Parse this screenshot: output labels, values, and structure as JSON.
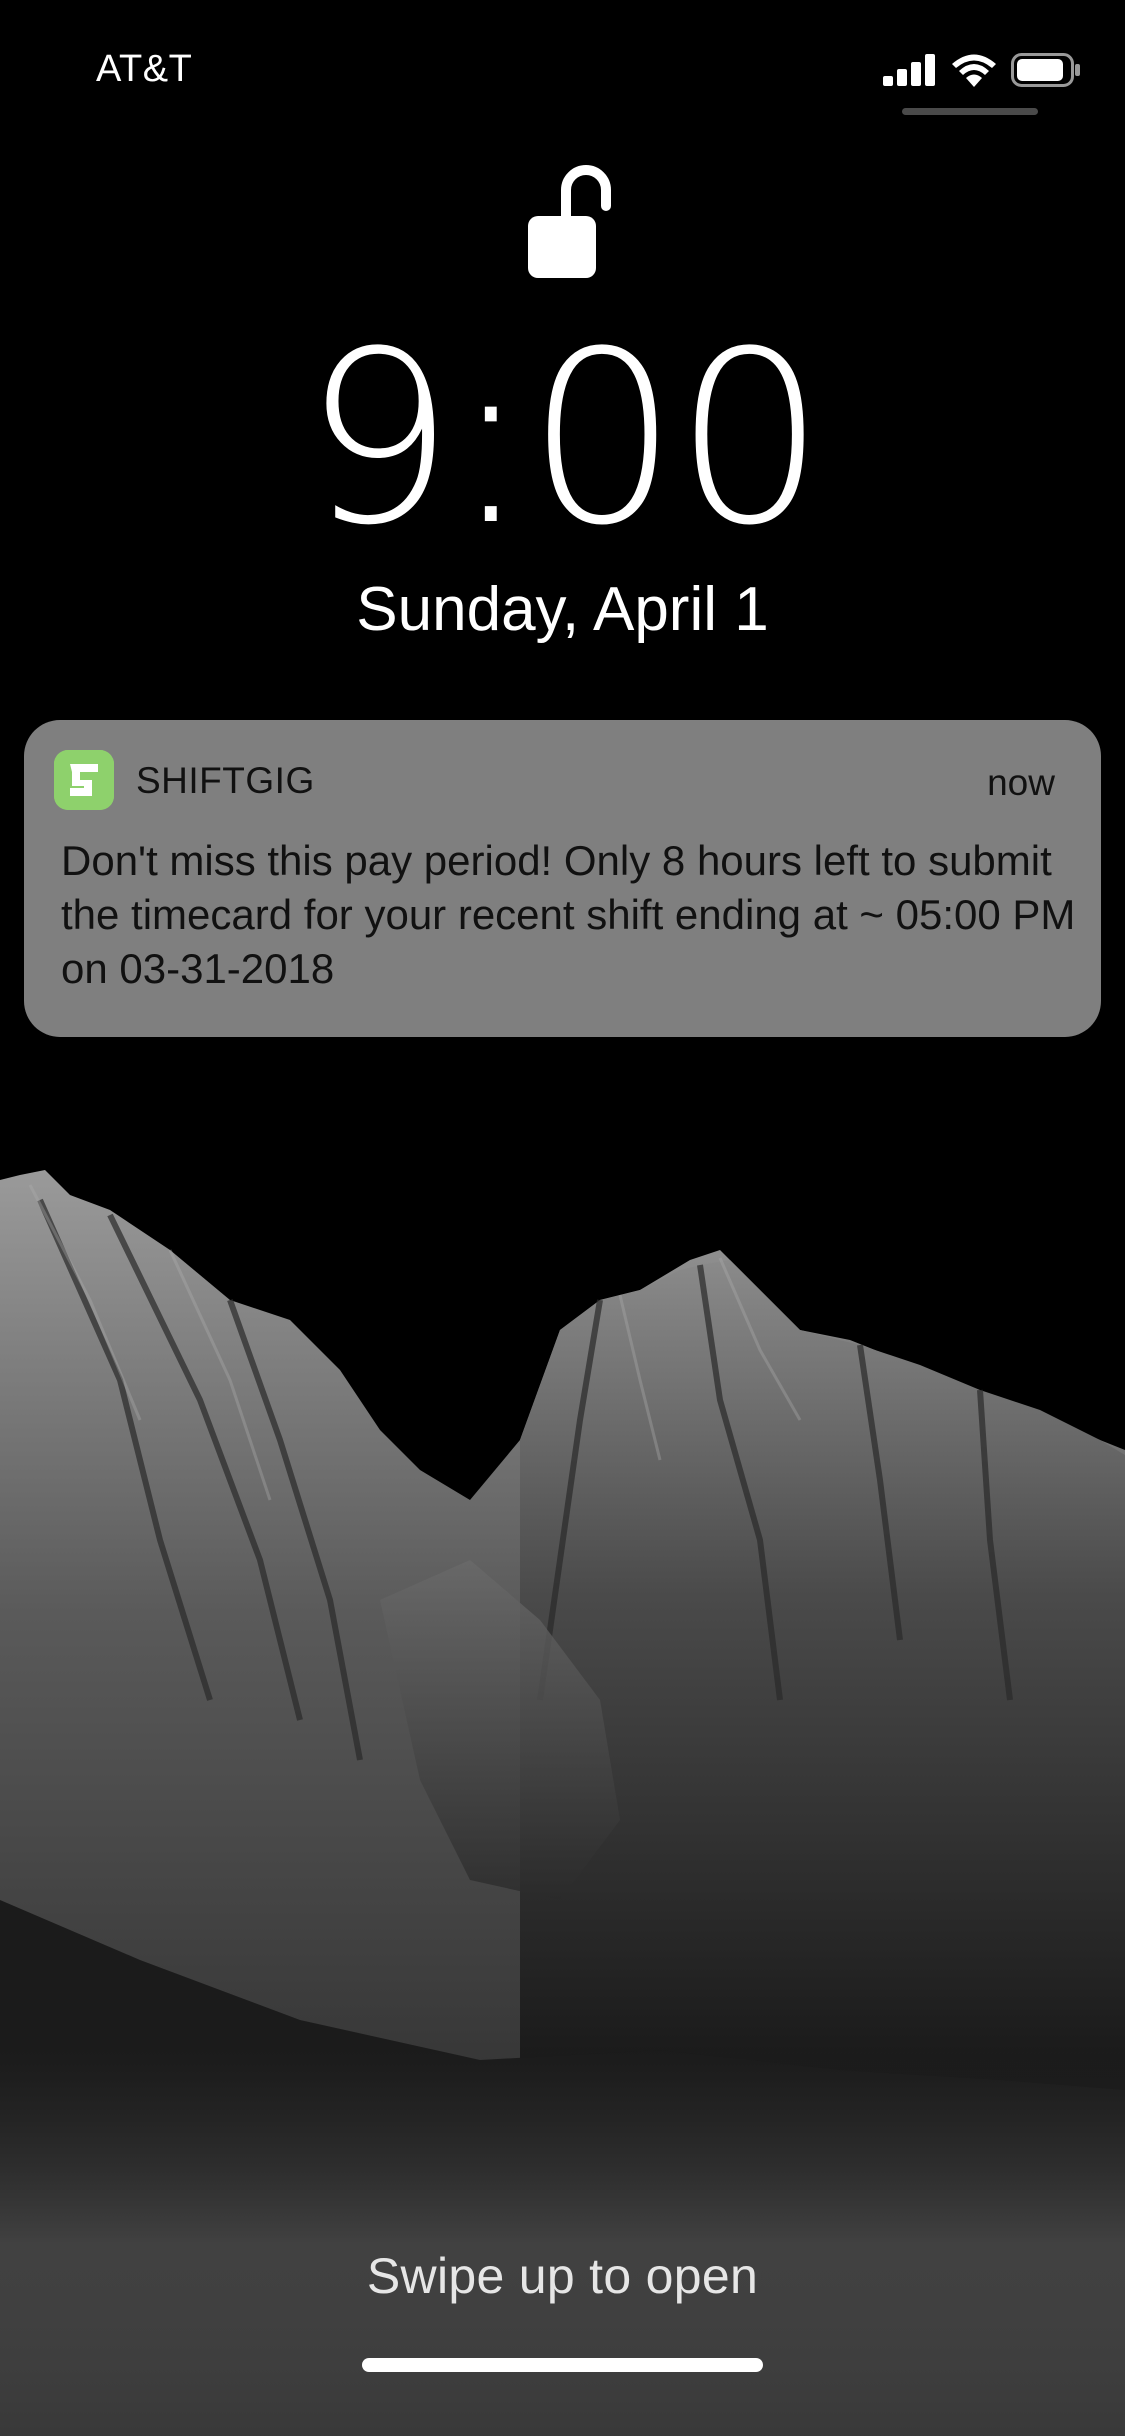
{
  "status_bar": {
    "carrier": "AT&T",
    "signal_icon": "cellular-signal-icon",
    "wifi_icon": "wifi-icon",
    "battery_icon": "battery-icon"
  },
  "lock": {
    "icon": "unlocked-padlock-icon"
  },
  "clock": {
    "time": "9:00",
    "date": "Sunday, April 1"
  },
  "notification": {
    "app_name": "SHIFTGIG",
    "time": "now",
    "body": "Don't miss this pay period! Only 8 hours left to submit the timecard for your recent shift ending at ~ 05:00 PM on 03-31-2018",
    "app_icon": "shiftgig-app-icon",
    "app_icon_color": "#8ed16c"
  },
  "footer": {
    "swipe_hint": "Swipe up to open"
  },
  "colors": {
    "background": "#000000",
    "notification_background": "#7f7f7f",
    "text_on_notification": "#111111"
  }
}
